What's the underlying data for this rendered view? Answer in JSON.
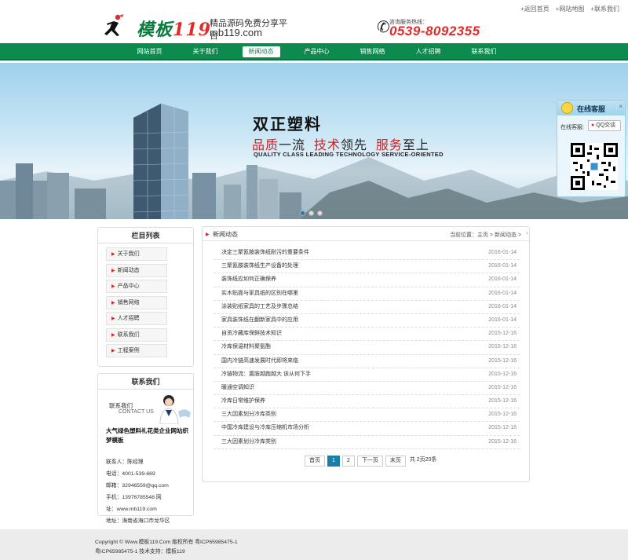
{
  "top_links": [
    "+返回首页",
    "+网站地图",
    "+联系我们"
  ],
  "logo": {
    "mark_a": "模板",
    "mark_b": "119",
    "tagline": "精品源码免费分享平台",
    "domain": "mb119.com"
  },
  "hotline": {
    "label": "咨询服务热线：",
    "number": "0539-8092355"
  },
  "nav": [
    "网站首页",
    "关于我们",
    "新闻动态",
    "产品中心",
    "销售网络",
    "人才招聘",
    "联系我们"
  ],
  "nav_active": "新闻动态",
  "banner": {
    "title": "双正塑料",
    "slogan_parts": [
      {
        "text": "品质",
        "red": true
      },
      {
        "text": "一流  ",
        "red": false
      },
      {
        "text": "技术",
        "red": true
      },
      {
        "text": "领先  ",
        "red": false
      },
      {
        "text": "服务",
        "red": true
      },
      {
        "text": "至上",
        "red": false
      }
    ],
    "english": "QUALITY CLASS LEADING TECHNOLOGY SERVICE-ORIENTED",
    "slide_count": 3,
    "slide_active": 1
  },
  "customer_service": {
    "title": "在线客服",
    "close": "×",
    "label": "在线客服:",
    "qq_button": "QQ交谈"
  },
  "category": {
    "title": "栏目列表",
    "items": [
      "关于我们",
      "新闻动态",
      "产品中心",
      "销售网络",
      "人才招聘",
      "联系我们",
      "工程案例"
    ]
  },
  "contact": {
    "title": "联系我们",
    "pic_cn": "联系我们",
    "pic_en": "CONTACT US",
    "company": "大气绿色塑料礼花类企业网站织梦模板",
    "lines": [
      "联系人：陈经理",
      "电话：4001-539-669",
      "邮箱：32946559@qq.com",
      "手机：13976785548 网",
      "址：www.mb119.com",
      "地址：海南省海口市龙华区"
    ]
  },
  "news": {
    "title": "新闻动态",
    "breadcrumb": "当前位置：主页 > 新闻动态 >",
    "items": [
      {
        "title": "决定三聚氰胺装饰纸耐污的重要条件",
        "date": "2016-01-14"
      },
      {
        "title": "三聚氰胺装饰纸生产设备的处理",
        "date": "2016-01-14"
      },
      {
        "title": "装饰纸应如何正确保养",
        "date": "2016-01-14"
      },
      {
        "title": "实木贴面与家具纸的区别在哪里",
        "date": "2016-01-14"
      },
      {
        "title": "涂装贴纸家具的工艺及步骤总结",
        "date": "2016-01-14"
      },
      {
        "title": "家具装饰纸在翻新家具中的应用",
        "date": "2016-01-14"
      },
      {
        "title": "自贡冷藏库保鲜技术知识",
        "date": "2015-12-16"
      },
      {
        "title": "冷库保温材料聚氨酯",
        "date": "2015-12-16"
      },
      {
        "title": "国内冷链高速发展时代即将来临",
        "date": "2015-12-16"
      },
      {
        "title": "冷链物流：置肢越跑越大 该从何下手",
        "date": "2015-12-16"
      },
      {
        "title": "暖通空调知识",
        "date": "2015-12-16"
      },
      {
        "title": "冷库日常维护保养",
        "date": "2015-12-16"
      },
      {
        "title": "三大因素划分冷库类别",
        "date": "2015-12-16"
      },
      {
        "title": "中国冷库建设与冷库压缩机市场分析",
        "date": "2015-12-16"
      },
      {
        "title": "三大因素划分冷库类别",
        "date": "2015-12-16"
      }
    ]
  },
  "pager": {
    "first": "首页",
    "pages": [
      "1",
      "2"
    ],
    "current": "1",
    "next": "下一页",
    "last": "末页",
    "info": "共 2页20条"
  },
  "footer": {
    "line1": "Copyright © Www.模板119.Com 版权所有 粤ICP65985475-1",
    "line2": "粤ICP65985475-1 技术支持：模板119"
  },
  "colors": {
    "nav_green": "#0d8a4e",
    "accent_red": "#e02b2b",
    "pager_blue": "#1a7fa8"
  }
}
